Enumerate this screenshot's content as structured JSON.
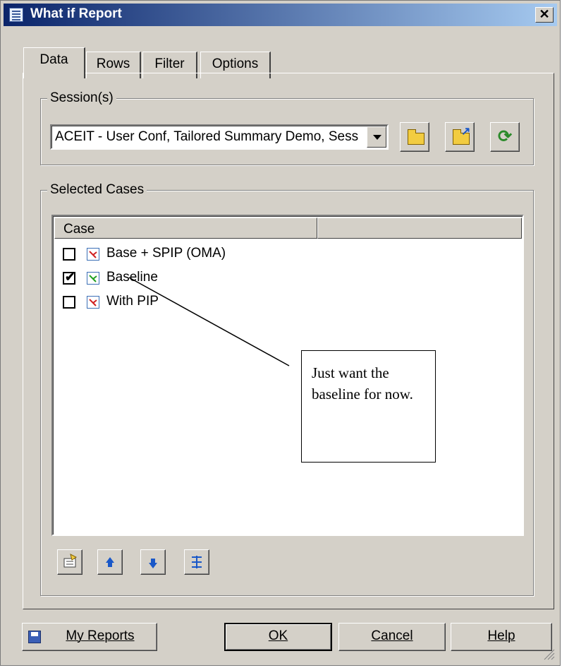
{
  "window": {
    "title": "What if Report",
    "close_symbol": "✕"
  },
  "tabs": [
    {
      "label": "Data",
      "active": true
    },
    {
      "label": "Rows",
      "active": false
    },
    {
      "label": "Filter",
      "active": false
    },
    {
      "label": "Options",
      "active": false
    }
  ],
  "sessions": {
    "group_label": "Session(s)",
    "selected": "ACEIT - User Conf, Tailored Summary Demo, Sess",
    "buttons": [
      {
        "icon": "open-folder-icon"
      },
      {
        "icon": "folder-export-icon"
      },
      {
        "icon": "refresh-icon"
      }
    ]
  },
  "cases": {
    "group_label": "Selected Cases",
    "column_header": "Case",
    "rows": [
      {
        "label": "Base + SPIP (OMA)",
        "checked": false,
        "icon_color": "#d02020"
      },
      {
        "label": "Baseline",
        "checked": true,
        "icon_color": "#20a020"
      },
      {
        "label": "With PIP",
        "checked": false,
        "icon_color": "#d02020"
      }
    ],
    "checkmark": "✔",
    "toolbar": [
      {
        "icon": "properties-icon"
      },
      {
        "icon": "move-up-icon"
      },
      {
        "icon": "move-down-icon"
      },
      {
        "icon": "sort-icon"
      }
    ]
  },
  "annotation": {
    "text": "Just want the baseline for now."
  },
  "footer": {
    "my_reports": "My Reports",
    "ok": "OK",
    "cancel": "Cancel",
    "help": "Help"
  }
}
